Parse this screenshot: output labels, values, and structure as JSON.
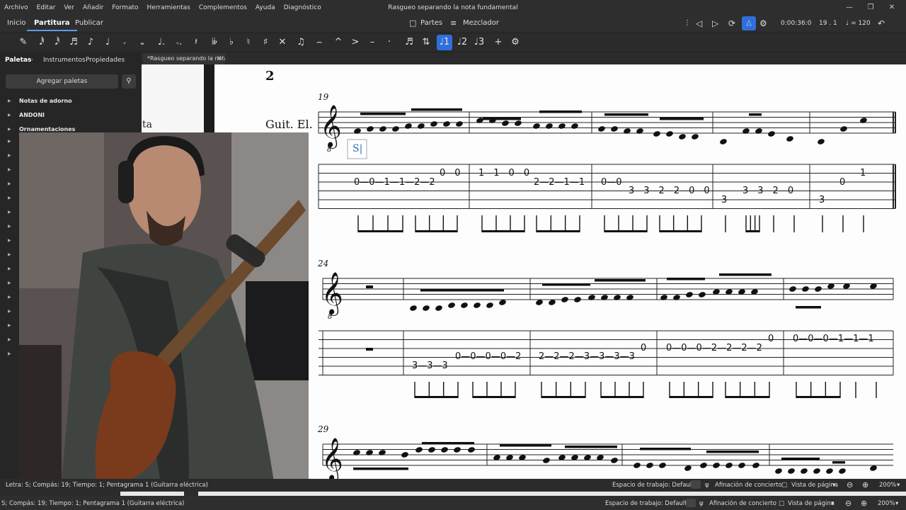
{
  "menubar": {
    "items": [
      "Archivo",
      "Editar",
      "Ver",
      "Añadir",
      "Formato",
      "Herramientas",
      "Complementos",
      "Ayuda",
      "Diagnóstico"
    ],
    "window_title": "Rasgueo separando la nota fundamental"
  },
  "header": {
    "tabs": [
      "Inicio",
      "Partitura",
      "Publicar"
    ],
    "active_tab": "Partitura",
    "parts_label": "Partes",
    "mixer_label": "Mezclador",
    "time": "0:00:36:0",
    "position": "19 . 1",
    "tempo": "♩ = 120"
  },
  "palette_panel": {
    "tabs": [
      "Paletas",
      "Instrumentos",
      "Propiedades"
    ],
    "add_label": "Agregar paletas",
    "rows": [
      "Notas de adorno",
      "ANDONI",
      "Ornamentaciones"
    ]
  },
  "document": {
    "tab_label": "*Rasgueo separando la nota...",
    "left_page_fragment": "ta",
    "page_number": "2",
    "instrument": "Guit. El.",
    "measure_numbers": [
      "19",
      "24",
      "29"
    ],
    "selected_lyric": "S|",
    "tab_row1": {
      "m19": "0—0—1—1—2—2",
      "m19_hi": "0—0",
      "m20": "1—1—0—0",
      "m20_lo": "2—2—1—1",
      "m21": "0—0",
      "m21_lo": "3—3—2—2—0—0",
      "m22_low": "3",
      "m22": "3—3—2—0",
      "m23_low": "3",
      "m23_mid": "0",
      "m23_hi": "1"
    },
    "tab_row2": {
      "m25": "3—3—3",
      "m25_hi": "0—0—0—0—2",
      "m26": "2—2—2—3—3—3—3",
      "m26_hi": "0",
      "m27": "0—0—0—2—2—2—2",
      "m27_hi": "0",
      "m28": "0—0—0—1—1—1"
    }
  },
  "status": {
    "text": "Letra: S; Compás: 19; Tiempo: 1; Pentagrama 1 (Guitarra eléctrica)",
    "workspace": "Espacio de trabajo: Default",
    "concert_pitch": "Afinación de concierto",
    "view": "Vista de página",
    "zoom": "200%"
  },
  "status2": {
    "text": "S; Compás: 19; Tiempo: 1; Pentagrama 1 (Guitarra eléctrica)",
    "workspace": "Espacio de trabajo: Default",
    "concert_pitch": "Afinación de concierto",
    "view": "Vista de página",
    "zoom": "200%"
  },
  "colors": {
    "accent": "#2f6fdc",
    "panel": "#262626",
    "page": "#fdfdfd"
  }
}
